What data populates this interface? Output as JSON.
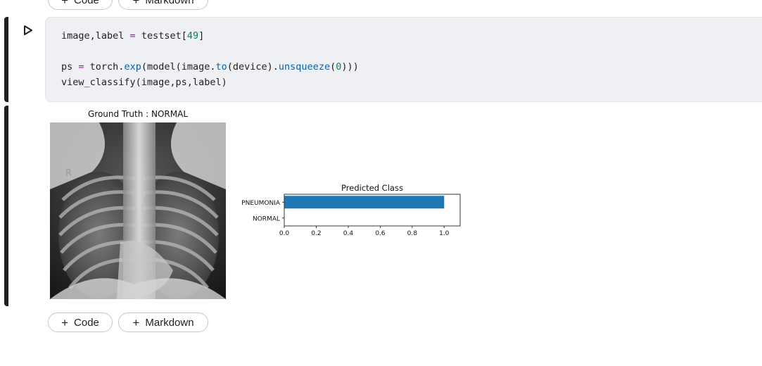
{
  "toolbar_top": {
    "code_label": "Code",
    "markdown_label": "Markdown"
  },
  "code_cell": {
    "lines": [
      "image,label = testset[49]",
      "ps = torch.exp(model(image.to(device).unsqueeze(0)))",
      "view_classify(image,ps,label)"
    ]
  },
  "output": {
    "image_title": "Ground Truth : NORMAL",
    "image_marker": "R",
    "chart_data": {
      "type": "bar",
      "orientation": "horizontal",
      "title": "Predicted Class",
      "categories": [
        "NORMAL",
        "PNEUMONIA"
      ],
      "values": [
        0.0,
        1.0
      ],
      "xlim": [
        0,
        1.1
      ],
      "xticks": [
        "0.0",
        "0.2",
        "0.4",
        "0.6",
        "0.8",
        "1.0"
      ],
      "bar_color": "#1f77b4"
    }
  },
  "toolbar_bottom": {
    "code_label": "Code",
    "markdown_label": "Markdown"
  }
}
